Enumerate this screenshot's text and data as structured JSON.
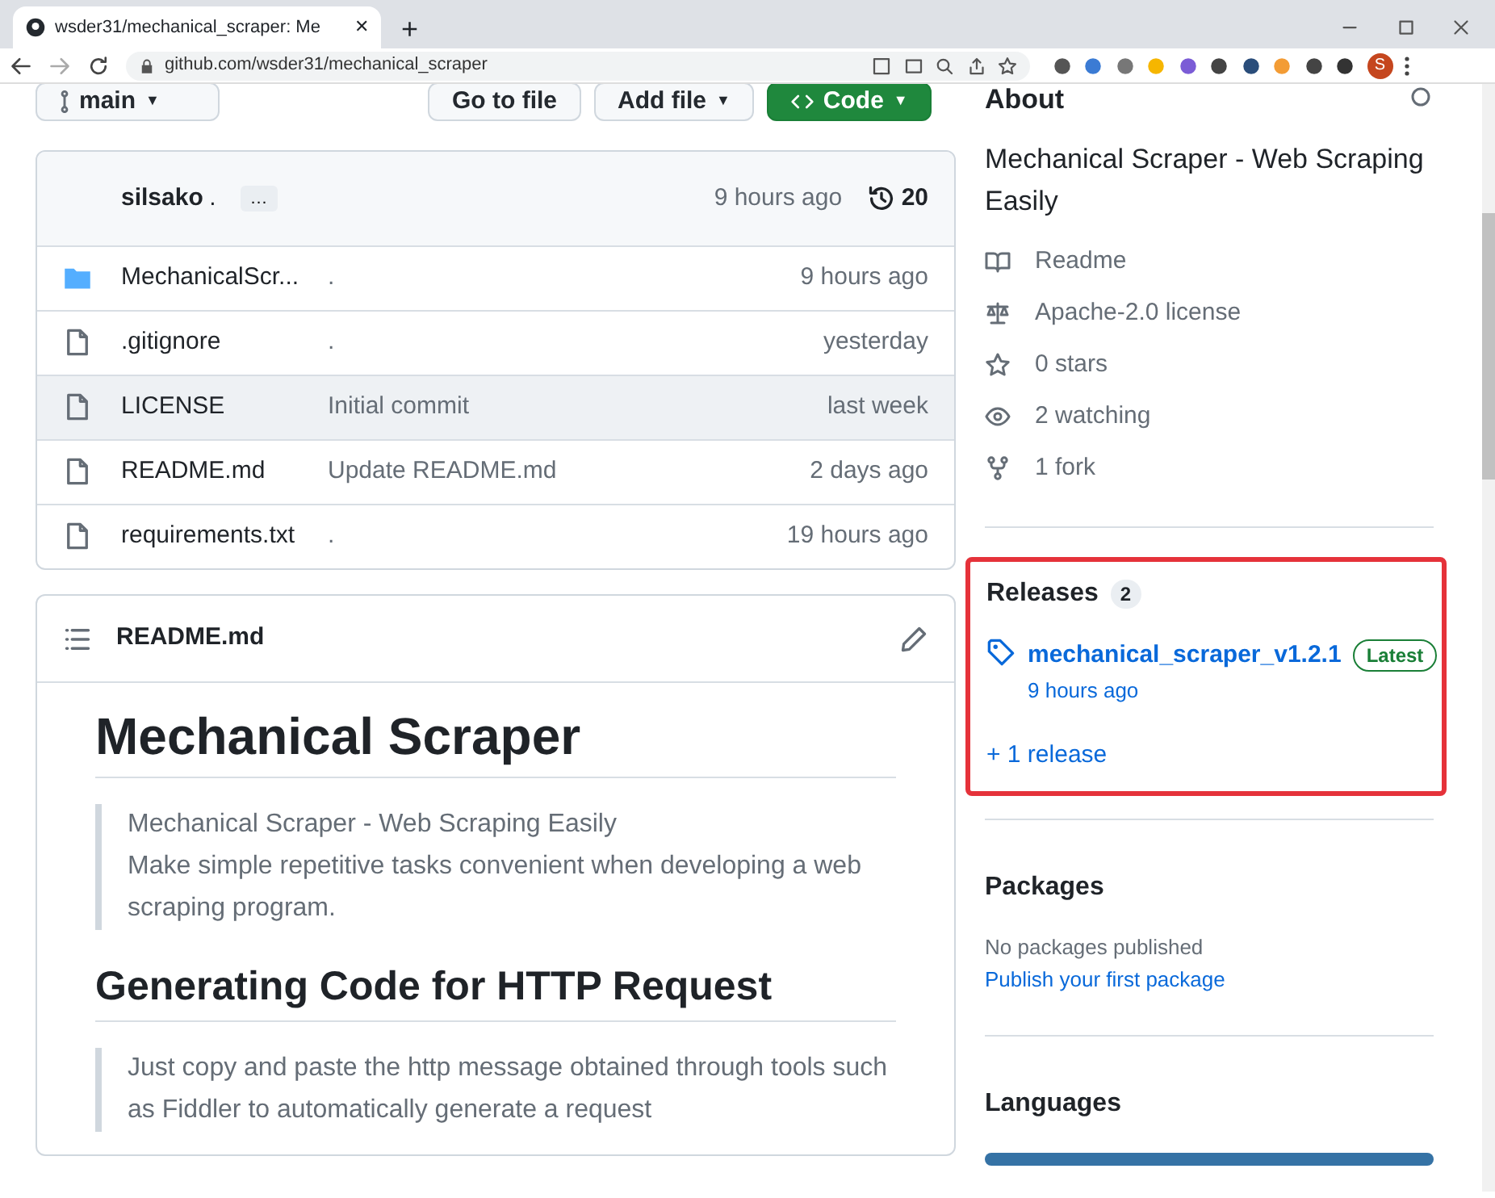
{
  "browser": {
    "tab_title": "wsder31/mechanical_scraper: Me",
    "tab_close": "✕",
    "new_tab": "+",
    "url": "github.com/wsder31/mechanical_scraper",
    "profile_initial": "S"
  },
  "toolbar": {
    "branch": "main",
    "branch_caret": "▼",
    "buttons": [
      {
        "kind": "plain",
        "label": "Go to file"
      },
      {
        "kind": "menu",
        "label": "Add file",
        "caret": "▼"
      },
      {
        "kind": "code",
        "label": "Code",
        "caret": "▼"
      }
    ]
  },
  "commit": {
    "author": "silsako",
    "message": ".",
    "more": "…",
    "time": "9 hours ago",
    "count": "20"
  },
  "files": [
    {
      "kind": "folder",
      "name": "MechanicalScr...",
      "message": ".",
      "time": "9 hours ago",
      "hovered": false
    },
    {
      "kind": "file",
      "name": ".gitignore",
      "message": ".",
      "time": "yesterday",
      "hovered": false
    },
    {
      "kind": "file",
      "name": "LICENSE",
      "message": "Initial commit",
      "time": "last week",
      "hovered": true
    },
    {
      "kind": "file",
      "name": "README.md",
      "message": "Update README.md",
      "time": "2 days ago",
      "hovered": false
    },
    {
      "kind": "file",
      "name": "requirements.txt",
      "message": ".",
      "time": "19 hours ago",
      "hovered": false
    }
  ],
  "readme": {
    "title": "README.md",
    "heading": "Mechanical Scraper",
    "quote": [
      "Mechanical Scraper - Web Scraping Easily",
      "Make simple repetitive tasks convenient when developing a web scraping program."
    ],
    "subheading": "Generating Code for HTTP Request",
    "quote2": "Just copy and paste the http message obtained through tools such as Fiddler to automatically generate a request"
  },
  "about": {
    "heading": "About",
    "description": "Mechanical Scraper - Web Scraping Easily",
    "items": [
      {
        "kind": "book",
        "text": "Readme"
      },
      {
        "kind": "scale",
        "text": "Apache-2.0 license"
      },
      {
        "kind": "star",
        "text": "0 stars"
      },
      {
        "kind": "eye",
        "text": "2 watching"
      },
      {
        "kind": "fork",
        "text": "1 fork"
      }
    ]
  },
  "releases": {
    "heading": "Releases",
    "count": "2",
    "highlighted": true,
    "latest": {
      "name": "mechanical_scraper_v1.2.1",
      "badge": "Latest",
      "time": "9 hours ago"
    },
    "more": "+ 1 release"
  },
  "packages": {
    "heading": "Packages",
    "note": "No packages published",
    "link": "Publish your first package"
  },
  "languages": {
    "heading": "Languages"
  }
}
